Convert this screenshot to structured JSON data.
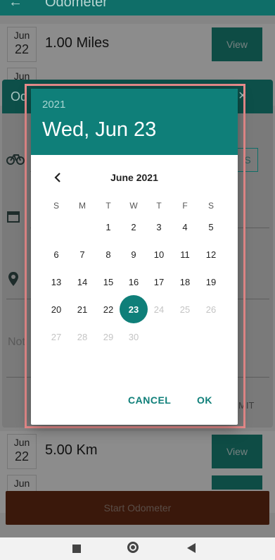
{
  "appbar": {
    "back_icon": "arrow-back-icon",
    "title": "Odometer"
  },
  "rows_top": [
    {
      "month": "Jun",
      "day": "22",
      "value": "1.00 Miles",
      "action": "View"
    },
    {
      "month": "Jun",
      "day": "",
      "value": "",
      "action": ""
    }
  ],
  "rows_bottom": [
    {
      "month": "Jun",
      "day": "22",
      "value": "5.00 Km",
      "action": "View"
    },
    {
      "month": "Jun",
      "day": "",
      "value": "",
      "action": ""
    }
  ],
  "bg_dialog": {
    "title": "Od",
    "close": "×",
    "notes_placeholder": "Not",
    "s_label": "S",
    "mit_label": "MIT"
  },
  "start_button": "Start Odometer",
  "picker": {
    "year": "2021",
    "selected_date": "Wed, Jun 23",
    "month_label": "June 2021",
    "weekdays": [
      "S",
      "M",
      "T",
      "W",
      "T",
      "F",
      "S"
    ],
    "weeks": [
      [
        "",
        "",
        "1",
        "2",
        "3",
        "4",
        "5"
      ],
      [
        "6",
        "7",
        "8",
        "9",
        "10",
        "11",
        "12"
      ],
      [
        "13",
        "14",
        "15",
        "16",
        "17",
        "18",
        "19"
      ],
      [
        "20",
        "21",
        "22",
        "23",
        "24",
        "25",
        "26"
      ],
      [
        "27",
        "28",
        "29",
        "30",
        "",
        "",
        ""
      ]
    ],
    "selected_day": "23",
    "disabled_from": 24,
    "cancel": "CANCEL",
    "ok": "OK",
    "accent": "#0f7f79"
  }
}
